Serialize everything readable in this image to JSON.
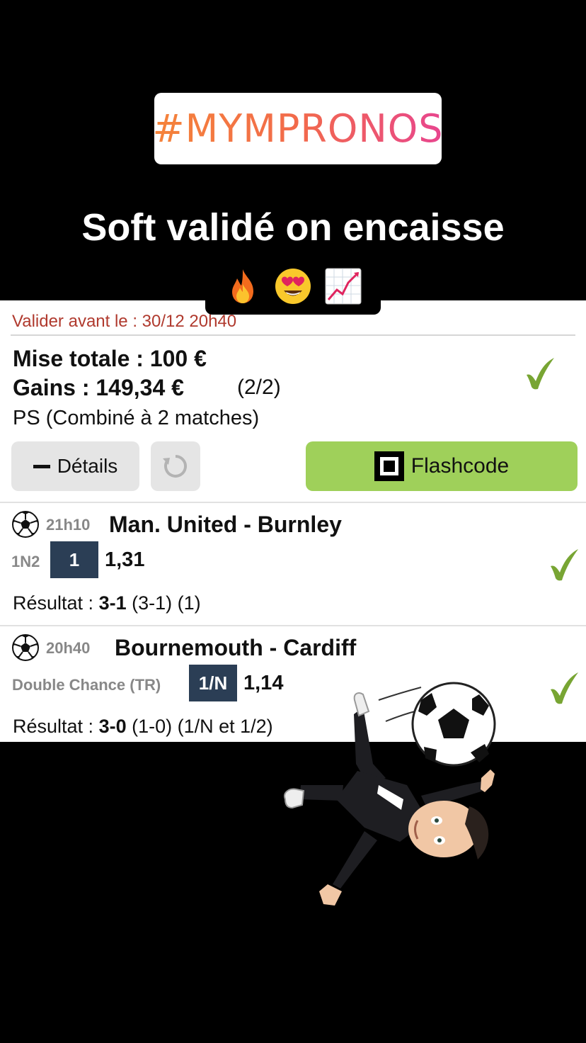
{
  "story": {
    "hashtag": "#MYMPRONOS",
    "headline": "Soft validé on encaisse",
    "emojis": [
      "fire-emoji",
      "heart-eyes-emoji",
      "chart-increasing-emoji"
    ]
  },
  "ticket": {
    "deadline": "Valider avant le : 30/12 20h40",
    "stake": "Mise totale : 100 €",
    "gains": "Gains : 149,34 €",
    "count": "(2/2)",
    "bet_type": "PS (Combiné à 2 matches)",
    "details_label": "Détails",
    "flashcode_label": "Flashcode",
    "status": "won",
    "accent_green": "#9fd05a",
    "check_green": "#78a533",
    "pick_color": "#2b3e55"
  },
  "matches": [
    {
      "time": "21h10",
      "teams": "Man. United - Burnley",
      "market": "1N2",
      "pick": "1",
      "odds": "1,31",
      "result_label": "Résultat : ",
      "result_score": "3-1",
      "result_detail": " (3-1) (1)"
    },
    {
      "time": "20h40",
      "teams": "Bournemouth - Cardiff",
      "market": "Double Chance (TR)",
      "pick": "1/N",
      "odds": "1,14",
      "result_label": "Résultat : ",
      "result_score": "3-0",
      "result_detail": " (1-0) (1/N et 1/2)"
    }
  ]
}
